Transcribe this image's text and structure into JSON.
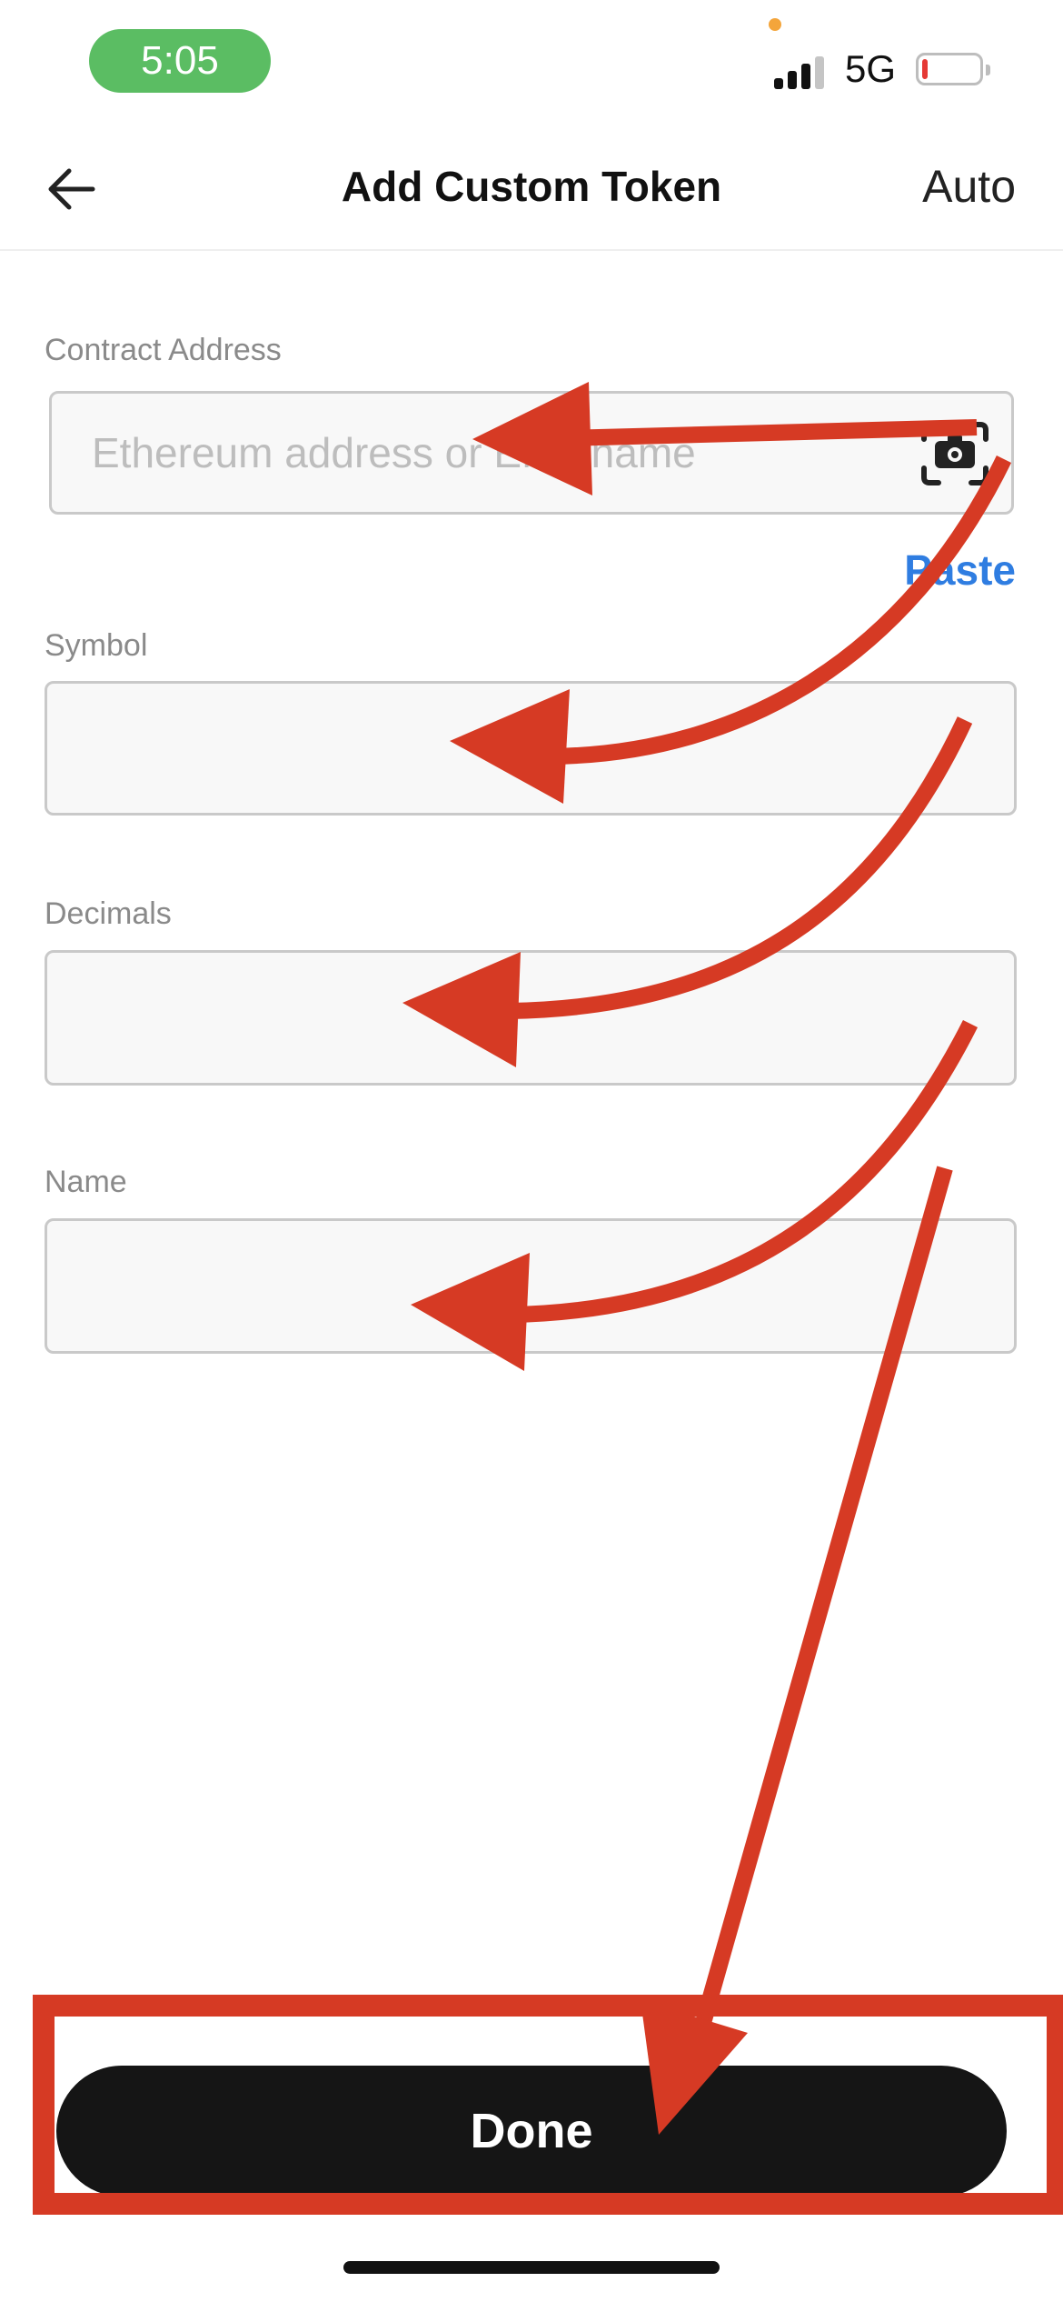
{
  "status_bar": {
    "time": "5:05",
    "network": "5G",
    "battery_level": 0.1,
    "colors": {
      "time_pill": "#5bbd63",
      "battery_low": "#e53935"
    }
  },
  "header": {
    "title": "Add Custom Token",
    "auto_label": "Auto",
    "back_icon": "arrow-left-icon"
  },
  "form": {
    "contract_address": {
      "label": "Contract Address",
      "value": "",
      "placeholder": "Ethereum address or ENS name",
      "scan_icon": "scan-qr-icon",
      "paste_label": "Paste"
    },
    "symbol": {
      "label": "Symbol",
      "value": ""
    },
    "decimals": {
      "label": "Decimals",
      "value": ""
    },
    "name": {
      "label": "Name",
      "value": ""
    }
  },
  "actions": {
    "done_label": "Done"
  },
  "annotation": {
    "color": "#d63a24",
    "highlight_target": "Done"
  }
}
